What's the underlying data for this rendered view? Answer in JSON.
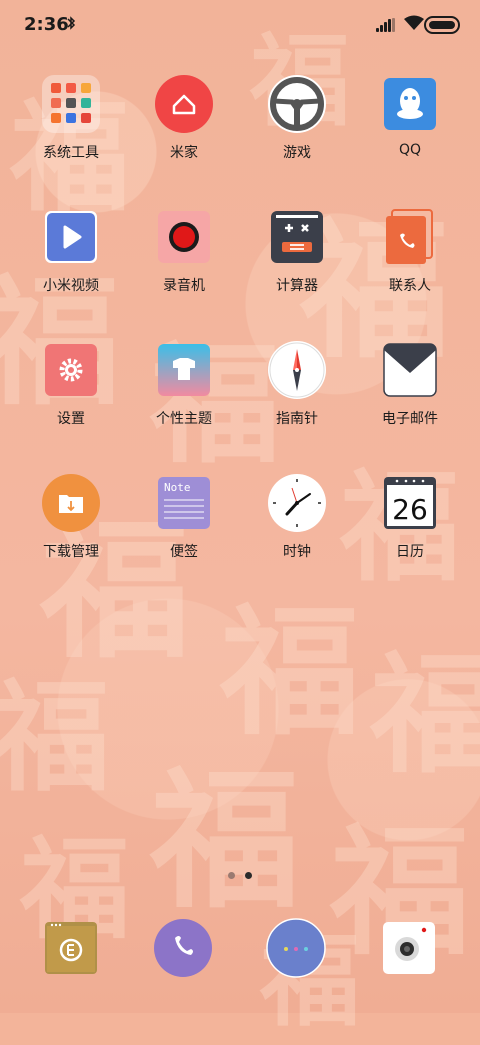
{
  "status_bar": {
    "time": "2:36",
    "bluetooth_icon": "bluetooth-icon",
    "signal_icon": "signal-icon",
    "wifi_icon": "wifi-icon",
    "battery_icon": "battery-icon"
  },
  "apps": [
    {
      "label": "系统工具",
      "icon": "system-tools-folder-icon"
    },
    {
      "label": "米家",
      "icon": "mijia-home-icon"
    },
    {
      "label": "游戏",
      "icon": "steering-wheel-icon"
    },
    {
      "label": "QQ",
      "icon": "qq-penguin-icon"
    },
    {
      "label": "小米视频",
      "icon": "video-play-icon"
    },
    {
      "label": "录音机",
      "icon": "recorder-icon"
    },
    {
      "label": "计算器",
      "icon": "calculator-icon"
    },
    {
      "label": "联系人",
      "icon": "contacts-icon"
    },
    {
      "label": "设置",
      "icon": "settings-gear-icon"
    },
    {
      "label": "个性主题",
      "icon": "theme-shirt-icon"
    },
    {
      "label": "指南针",
      "icon": "compass-icon"
    },
    {
      "label": "电子邮件",
      "icon": "email-envelope-icon"
    },
    {
      "label": "下载管理",
      "icon": "download-folder-icon"
    },
    {
      "label": "便签",
      "icon": "notes-icon",
      "icon_text": "Note"
    },
    {
      "label": "时钟",
      "icon": "clock-icon"
    },
    {
      "label": "日历",
      "icon": "calendar-icon",
      "icon_text": "26"
    }
  ],
  "page_indicator": {
    "pages": 2,
    "active": 2
  },
  "dock": [
    {
      "icon": "file-manager-icon"
    },
    {
      "icon": "phone-icon"
    },
    {
      "icon": "messages-icon"
    },
    {
      "icon": "camera-icon"
    }
  ],
  "colors": {
    "wallpaper": "#f3b49a",
    "mijia": "#f04545",
    "qq": "#3c8ce0",
    "video": "#5b7ad8",
    "recorder_bg": "#f6a6a6",
    "calculator": "#3b3f4a",
    "contacts": "#ec6a3e",
    "settings": "#f07575",
    "download": "#f0913f",
    "notes": "#9e8ed6",
    "phone": "#8c74c8",
    "messages": "#6a80cc"
  }
}
